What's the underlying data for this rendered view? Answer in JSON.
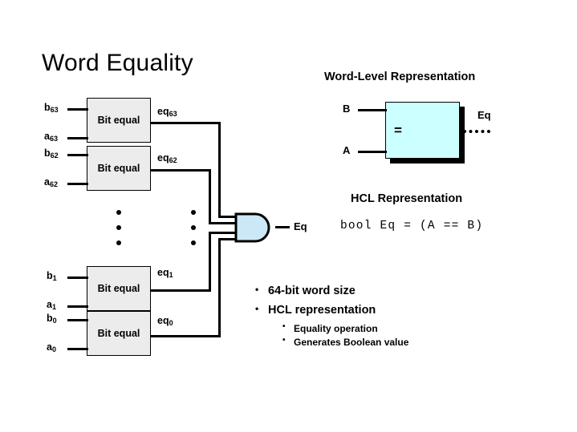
{
  "slide": {
    "title": "Word Equality"
  },
  "bit_level": {
    "boxes": [
      {
        "label": "Bit equal"
      },
      {
        "label": "Bit equal"
      },
      {
        "label": "Bit equal"
      },
      {
        "label": "Bit equal"
      }
    ],
    "inputs": [
      {
        "name": "b",
        "sub": "63"
      },
      {
        "name": "a",
        "sub": "63"
      },
      {
        "name": "b",
        "sub": "62"
      },
      {
        "name": "a",
        "sub": "62"
      },
      {
        "name": "b",
        "sub": "1"
      },
      {
        "name": "a",
        "sub": "1"
      },
      {
        "name": "b",
        "sub": "0"
      },
      {
        "name": "a",
        "sub": "0"
      }
    ],
    "eq_wires": [
      {
        "name": "eq",
        "sub": "63"
      },
      {
        "name": "eq",
        "sub": "62"
      },
      {
        "name": "eq",
        "sub": "1"
      },
      {
        "name": "eq",
        "sub": "0"
      }
    ],
    "gate": {
      "type": "and-gate",
      "output_label": "Eq",
      "fill": "#cce8f7"
    },
    "ellipsis_dots": 3
  },
  "word_level": {
    "heading": "Word-Level Representation",
    "input_top": "B",
    "input_bottom": "A",
    "operator": "=",
    "output": "Eq",
    "box_fill": "#ccffff"
  },
  "hcl": {
    "heading": "HCL Representation",
    "code": "bool Eq = (A == B)"
  },
  "bullets": {
    "level1": [
      "64-bit word size",
      "HCL representation"
    ],
    "level2": [
      "Equality operation",
      "Generates Boolean value"
    ]
  }
}
